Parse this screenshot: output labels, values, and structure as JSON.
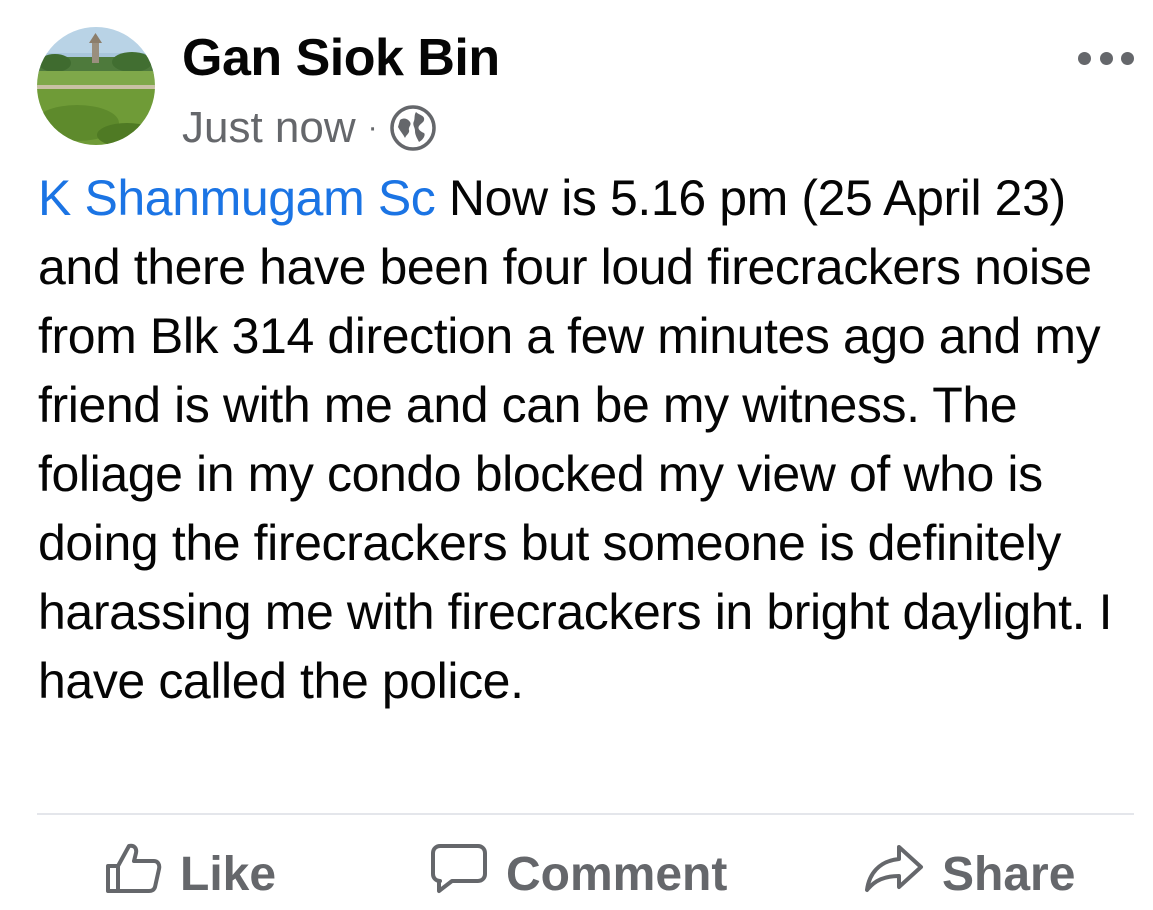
{
  "post": {
    "author_name": "Gan Siok Bin",
    "timestamp": "Just now",
    "separator": "·",
    "audience_icon": "globe-icon",
    "more_icon": "more-horizontal-icon",
    "avatar_icon": "profile-photo-landscape",
    "mention": "K Shanmugam Sc",
    "body_text": "Now is 5.16 pm (25 April 23) and there have been four loud firecrackers noise from Blk 314 direction a few minutes ago and my friend is with  me and can be my witness. The foliage in my condo blocked my view of who is doing the firecrackers but someone is definitely harassing me with firecrackers in bright daylight. I have called the police."
  },
  "actions": {
    "like_label": "Like",
    "like_icon": "thumbs-up-icon",
    "comment_label": "Comment",
    "comment_icon": "comment-bubble-icon",
    "share_label": "Share",
    "share_icon": "share-arrow-icon"
  },
  "colors": {
    "text_primary": "#050505",
    "text_secondary": "#65676b",
    "mention_link": "#1b74e4",
    "divider": "#e4e6eb"
  }
}
